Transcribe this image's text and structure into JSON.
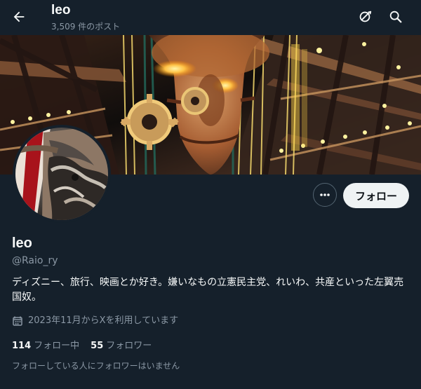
{
  "header": {
    "title": "leo",
    "post_count": "3,509 件のポスト",
    "icons": {
      "back": "arrow-left-icon",
      "notifications": "no-alerts-icon",
      "search": "search-icon"
    }
  },
  "profile": {
    "display_name": "leo",
    "handle": "@Raio_ry",
    "bio": "ディズニー、旅行、映画とか好き。嫌いなもの立憲民主党、れいわ、共産といった左翼売国奴。",
    "joined": "2023年11月からXを利用しています",
    "following_count": "114",
    "following_label": "フォロー中",
    "followers_count": "55",
    "followers_label": "フォロワー",
    "mutual_note": "フォローしている人にフォロワーはいません"
  },
  "actions": {
    "more_icon": "ellipsis-icon",
    "follow_label": "フォロー"
  },
  "colors": {
    "background": "#15202b",
    "primary_text": "#f7f9f9",
    "secondary_text": "#8b98a5",
    "button_background": "#eff3f4",
    "button_text": "#0f1419",
    "border": "#536471"
  }
}
